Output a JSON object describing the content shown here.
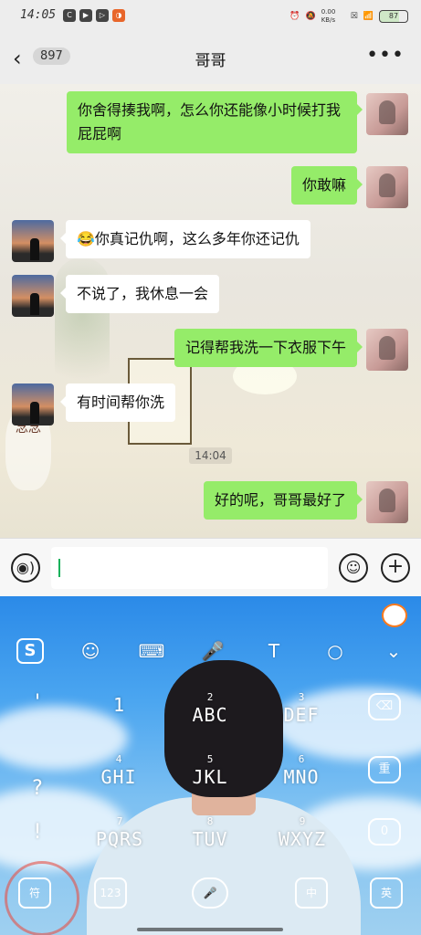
{
  "status_bar": {
    "time": "14:05",
    "app_icons": [
      "C",
      "▶",
      "▷",
      "◑"
    ],
    "net_speed": "0.00 KB/s",
    "battery": "87"
  },
  "header": {
    "back_icon": "chevron-left",
    "unread_count": "897",
    "title": "哥哥",
    "more_icon": "more-dots"
  },
  "messages": [
    {
      "from": "me",
      "text": "你舍得揍我啊，怎么你还能像小时候打我屁屁啊"
    },
    {
      "from": "me",
      "text": "你敢嘛"
    },
    {
      "from": "other",
      "text": "😂你真记仇啊，这么多年你还记仇"
    },
    {
      "from": "other",
      "text": "不说了，我休息一会"
    },
    {
      "from": "me",
      "text": "记得帮我洗一下衣服下午"
    },
    {
      "from": "other",
      "text": "有时间帮你洗"
    },
    {
      "from": "me",
      "text": "好的呢，哥哥最好了"
    }
  ],
  "timestamp": "14:04",
  "background_art": {
    "calligraphy": "念念"
  },
  "input_bar": {
    "voice_icon": "voice-icon",
    "emoji_icon": "emoji-icon",
    "plus_icon": "plus-icon"
  },
  "keyboard": {
    "brand": "S",
    "toolbar": [
      "☺",
      "⌨",
      "🎤",
      "T",
      "○",
      "⌄"
    ],
    "punctuation": [
      "'",
      "?",
      "!"
    ],
    "keys": [
      {
        "num": "1",
        "letters": ""
      },
      {
        "num": "2",
        "letters": "ABC"
      },
      {
        "num": "3",
        "letters": "DEF"
      },
      {
        "num": "4",
        "letters": "GHI"
      },
      {
        "num": "5",
        "letters": "JKL"
      },
      {
        "num": "6",
        "letters": "MNO"
      },
      {
        "num": "7",
        "letters": "PQRS"
      },
      {
        "num": "8",
        "letters": "TUV"
      },
      {
        "num": "9",
        "letters": "WXYZ"
      }
    ],
    "side_keys": [
      "⌫",
      "重",
      "0"
    ],
    "bottom_keys": [
      "符",
      "123",
      "中",
      "英"
    ]
  }
}
